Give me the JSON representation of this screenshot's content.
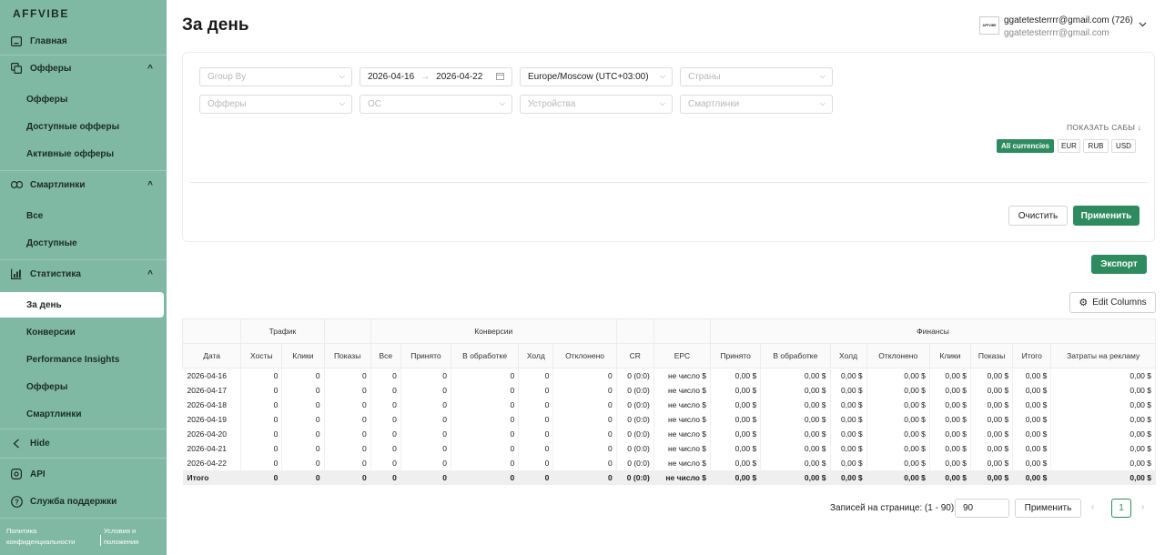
{
  "brand": {
    "logo": "AFFVIBE",
    "accent": "#2e8b60",
    "sidebar_bg": "#7fb9a3"
  },
  "sidebar": {
    "main": "Главная",
    "offers": {
      "label": "Офферы",
      "items": [
        "Офферы",
        "Доступные офферы",
        "Активные офферы"
      ]
    },
    "smartlinks": {
      "label": "Смартлинки",
      "items": [
        "Все",
        "Доступные"
      ]
    },
    "stats": {
      "label": "Статистика",
      "items": [
        "За день",
        "Конверсии",
        "Performance Insights",
        "Офферы",
        "Смартлинки"
      ]
    },
    "hide": "Hide",
    "api": "API",
    "support": "Служба поддержки",
    "footer": {
      "privacy": "Политика конфиденциальности",
      "terms": "Условия и положения"
    }
  },
  "header": {
    "title": "За день",
    "user_logo": "AFFVIBE",
    "user_email_line": "ggatetesterrrr@gmail.com (726)",
    "user_email_sub": "ggatetesterrrr@gmail.com"
  },
  "filters": {
    "group_by": "Group By",
    "date_from": "2026-04-16",
    "date_arrow": "→",
    "date_to": "2026-04-22",
    "timezone": "Europe/Moscow (UTC+03:00)",
    "countries": "Страны",
    "offers": "Офферы",
    "os": "ОС",
    "devices": "Устройства",
    "smartlinks": "Смартлинки",
    "show_subs": "ПОКАЗАТЬ САБЫ ↓",
    "currencies": [
      "All currencies",
      "EUR",
      "RUB",
      "USD"
    ],
    "clear": "Очистить",
    "apply": "Применить"
  },
  "actions": {
    "export": "Экспорт",
    "edit_columns": "Edit Columns"
  },
  "table": {
    "groups": {
      "traffic": "Трафик",
      "conversions": "Конверсии",
      "finance": "Финансы"
    },
    "columns": [
      "Дата",
      "Хосты",
      "Клики",
      "Показы",
      "Все",
      "Принято",
      "В обработке",
      "Холд",
      "Отклонено",
      "CR",
      "EPC",
      "Принято",
      "В обработке",
      "Холд",
      "Отклонено",
      "Клики",
      "Показы",
      "Итого",
      "Затраты на рекламу"
    ],
    "rows": [
      [
        "2026-04-16",
        "0",
        "0",
        "0",
        "0",
        "0",
        "0",
        "0",
        "0",
        "0 (0:0)",
        "не число $",
        "0,00 $",
        "0,00 $",
        "0,00 $",
        "0,00 $",
        "0,00 $",
        "0,00 $",
        "0,00 $",
        "0,00 $"
      ],
      [
        "2026-04-17",
        "0",
        "0",
        "0",
        "0",
        "0",
        "0",
        "0",
        "0",
        "0 (0:0)",
        "не число $",
        "0,00 $",
        "0,00 $",
        "0,00 $",
        "0,00 $",
        "0,00 $",
        "0,00 $",
        "0,00 $",
        "0,00 $"
      ],
      [
        "2026-04-18",
        "0",
        "0",
        "0",
        "0",
        "0",
        "0",
        "0",
        "0",
        "0 (0:0)",
        "не число $",
        "0,00 $",
        "0,00 $",
        "0,00 $",
        "0,00 $",
        "0,00 $",
        "0,00 $",
        "0,00 $",
        "0,00 $"
      ],
      [
        "2026-04-19",
        "0",
        "0",
        "0",
        "0",
        "0",
        "0",
        "0",
        "0",
        "0 (0:0)",
        "не число $",
        "0,00 $",
        "0,00 $",
        "0,00 $",
        "0,00 $",
        "0,00 $",
        "0,00 $",
        "0,00 $",
        "0,00 $"
      ],
      [
        "2026-04-20",
        "0",
        "0",
        "0",
        "0",
        "0",
        "0",
        "0",
        "0",
        "0 (0:0)",
        "не число $",
        "0,00 $",
        "0,00 $",
        "0,00 $",
        "0,00 $",
        "0,00 $",
        "0,00 $",
        "0,00 $",
        "0,00 $"
      ],
      [
        "2026-04-21",
        "0",
        "0",
        "0",
        "0",
        "0",
        "0",
        "0",
        "0",
        "0 (0:0)",
        "не число $",
        "0,00 $",
        "0,00 $",
        "0,00 $",
        "0,00 $",
        "0,00 $",
        "0,00 $",
        "0,00 $",
        "0,00 $"
      ],
      [
        "2026-04-22",
        "0",
        "0",
        "0",
        "0",
        "0",
        "0",
        "0",
        "0",
        "0 (0:0)",
        "не число $",
        "0,00 $",
        "0,00 $",
        "0,00 $",
        "0,00 $",
        "0,00 $",
        "0,00 $",
        "0,00 $",
        "0,00 $"
      ]
    ],
    "total": [
      "Итого",
      "0",
      "0",
      "0",
      "0",
      "0",
      "0",
      "0",
      "0",
      "0 (0:0)",
      "не число $",
      "0,00 $",
      "0,00 $",
      "0,00 $",
      "0,00 $",
      "0,00 $",
      "0,00 $",
      "0,00 $",
      "0,00 $"
    ]
  },
  "pagination": {
    "label": "Записей на странице: (1 - 90)",
    "per_page": "90",
    "apply": "Применить",
    "current_page": "1",
    "prev": "‹",
    "next": "›"
  }
}
